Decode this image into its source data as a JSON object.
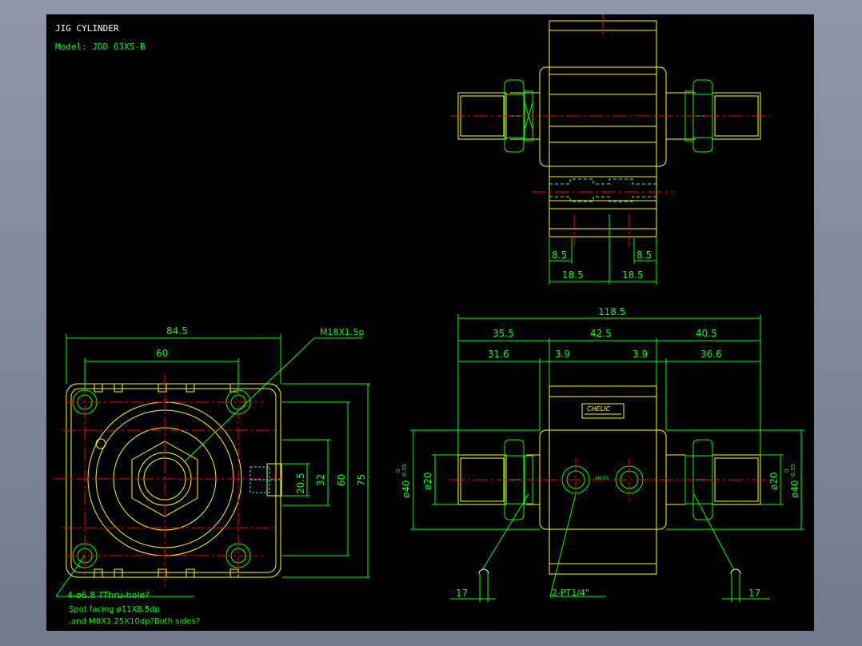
{
  "title": {
    "line1": "JIG  CYLINDER",
    "line2": "Model:  JDD  63X5-B"
  },
  "dimensions": {
    "top_view": {
      "d_8_5_left": "8.5",
      "d_8_5_right": "8.5",
      "d_18_5_left": "18.5",
      "d_18_5_right": "18.5"
    },
    "front_view": {
      "d_84_5": "84.5",
      "d_60_h": "60",
      "thread_label": "M18X1.5p",
      "d_20_5": "20.5",
      "d_32": "32",
      "d_60_v": "60",
      "d_75": "75",
      "note_1": "4-ø6.8  ?Thru-hole?",
      "note_2": "Spot  facing  ø11X8.5dp",
      "note_3": ",and M8X1.25X10dp?Both  sides?"
    },
    "side_view": {
      "d_118_5": "118.5",
      "d_35_5": "35.5",
      "d_42_5": "42.5",
      "d_40_5": "40.5",
      "d_31_6": "31.6",
      "d_3_9_left": "3.9",
      "d_3_9_right": "3.9",
      "d_36_6": "36.6",
      "d_dia20_left": "ø20",
      "d_dia40_left": "ø40",
      "tol_left_upper": "0",
      "tol_left_lower": "-0.05",
      "d_dia20_right": "ø20",
      "d_dia40_right": "ø40",
      "tol_right_upper": "0",
      "tol_right_lower": "-0.05",
      "d_17_left": "17",
      "d_17_right": "17",
      "port_label": "2-PT1/4\"",
      "brand": "CHELIC",
      "small_mark": "ø0.03"
    }
  },
  "colors": {
    "background": "#000000",
    "outline": "#ffff00",
    "dimension": "#00ff00",
    "center_line": "#ff0000",
    "hidden_line": "#00ffff",
    "text_title": "#ffffff"
  }
}
